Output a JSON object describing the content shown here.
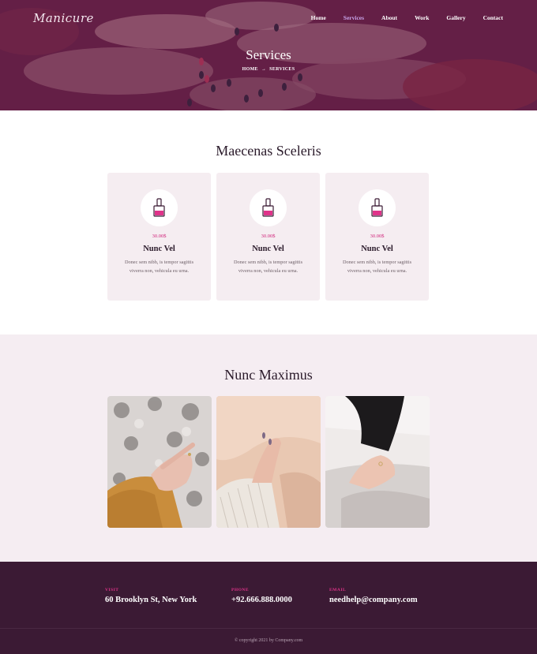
{
  "header": {
    "logo": "Manicure",
    "nav": [
      {
        "label": "Home",
        "active": false
      },
      {
        "label": "Services",
        "active": true
      },
      {
        "label": "About",
        "active": false
      },
      {
        "label": "Work",
        "active": false
      },
      {
        "label": "Gallery",
        "active": false
      },
      {
        "label": "Contact",
        "active": false
      }
    ],
    "title": "Services",
    "breadcrumb": {
      "home": "HOME",
      "arrow": "→",
      "current": "SERVICES"
    }
  },
  "services": {
    "heading": "Maecenas Sceleris",
    "icon": "nail-polish-icon",
    "cards": [
      {
        "price": "30.00$",
        "name": "Nunc Vel",
        "description": "Donec sem nibh, is tempor sagittis viverra non, vehicula eu urna."
      },
      {
        "price": "30.00$",
        "name": "Nunc Vel",
        "description": "Donec sem nibh, is tempor sagittis viverra non, vehicula eu urna."
      },
      {
        "price": "30.00$",
        "name": "Nunc Vel",
        "description": "Donec sem nibh, is tempor sagittis viverra non, vehicula eu urna."
      }
    ]
  },
  "gallery": {
    "heading": "Nunc Maximus"
  },
  "footer": {
    "visit_label": "VISIT",
    "visit_value": "60 Brooklyn St, New York",
    "phone_label": "PHONE",
    "phone_value": "+92.666.888.0000",
    "email_label": "EMAIL",
    "email_value": "needhelp@company.com",
    "copyright": "© copyright 2021 by Company.com"
  },
  "colors": {
    "accent": "#d0237a",
    "footer_bg": "#3b1a34",
    "card_bg": "#f5edf1",
    "nav_active": "#c7a3e8"
  }
}
